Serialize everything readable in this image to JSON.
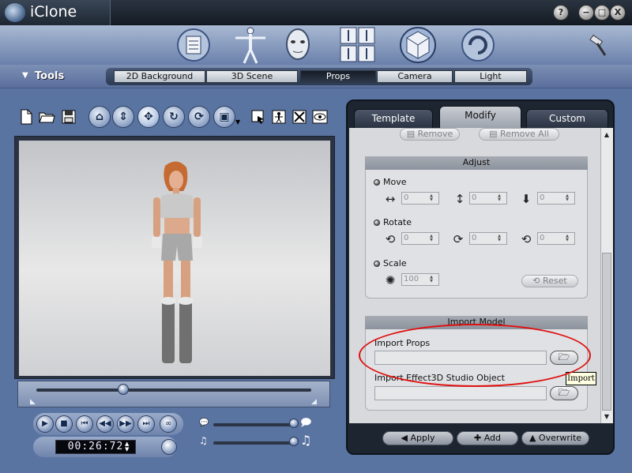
{
  "app": {
    "title": "iClone"
  },
  "window_buttons": [
    {
      "name": "help-button",
      "glyph": "?"
    },
    {
      "name": "minimize-button",
      "glyph": "−"
    },
    {
      "name": "maximize-button",
      "glyph": "□"
    },
    {
      "name": "close-button",
      "glyph": "X"
    }
  ],
  "tools": {
    "label": "Tools",
    "arrow": "▼"
  },
  "module_tabs": [
    {
      "label": "2D Background",
      "active": false
    },
    {
      "label": "3D Scene",
      "active": false
    },
    {
      "label": "Props",
      "active": true
    },
    {
      "label": "Camera",
      "active": false
    },
    {
      "label": "Light",
      "active": false
    }
  ],
  "panel_tabs": [
    {
      "label": "Template",
      "active": false
    },
    {
      "label": "Modify",
      "active": true
    },
    {
      "label": "Custom",
      "active": false
    }
  ],
  "top_buttons": {
    "remove": "Remove",
    "remove_all": "Remove All"
  },
  "adjust": {
    "title": "Adjust",
    "move": {
      "label": "Move",
      "values": [
        "0",
        "0",
        "0"
      ]
    },
    "rotate": {
      "label": "Rotate",
      "values": [
        "0",
        "0",
        "0"
      ]
    },
    "scale": {
      "label": "Scale",
      "value": "100"
    },
    "reset": "Reset"
  },
  "import_model": {
    "title": "Import Model",
    "import_props_label": "Import Props",
    "import_effect_label": "Import Effect3D Studio Object",
    "tooltip": "Import"
  },
  "bottom_buttons": {
    "apply": "Apply",
    "add": "Add",
    "overwrite": "Overwrite"
  },
  "playback": {
    "time": "00:26:72"
  },
  "colors": {
    "accent": "#5a74a2",
    "highlight": "#e01010",
    "panel_bg": "#d7d9dc"
  }
}
